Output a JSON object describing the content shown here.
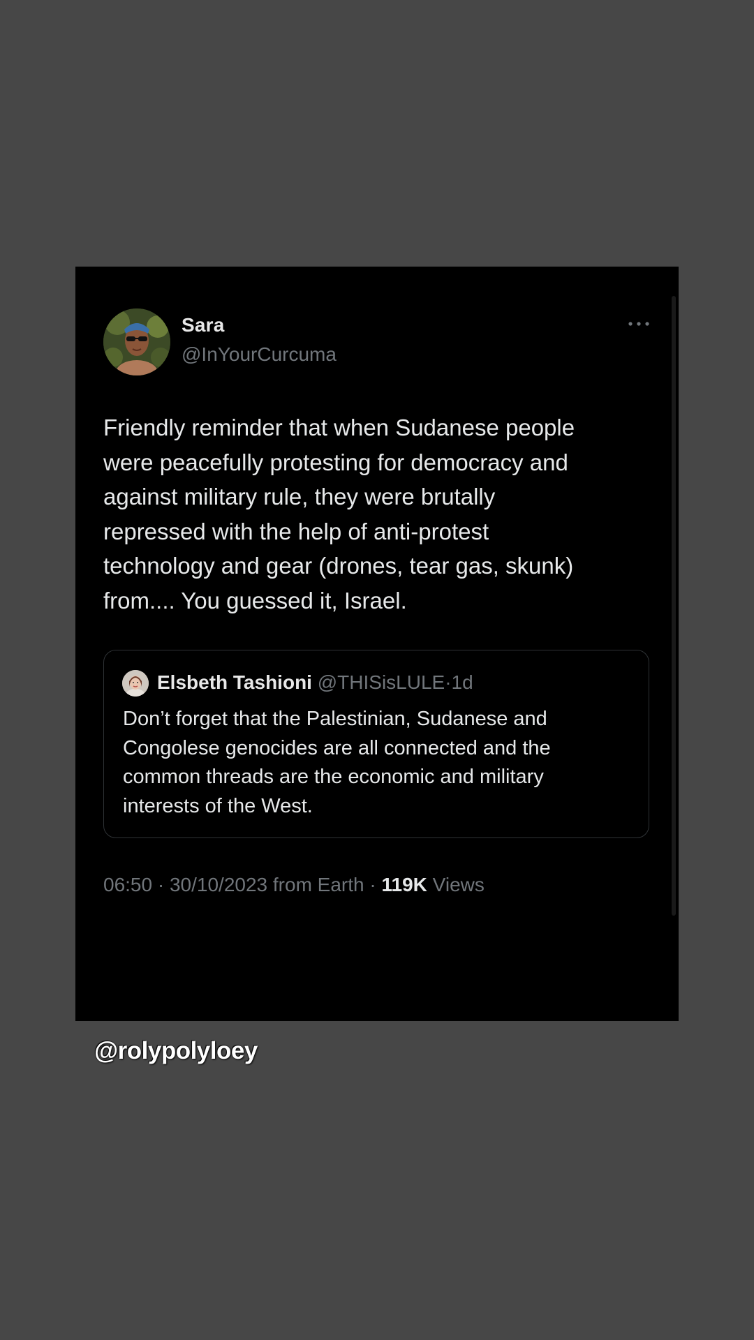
{
  "tweet": {
    "author": {
      "display_name": "Sara",
      "handle": "@InYourCurcuma",
      "avatar_icon": "profile-photo"
    },
    "more_icon": "ellipsis-icon",
    "text": "Friendly reminder that when Sudanese people\nwere peacefully protesting for democracy and\nagainst military rule, they were brutally\nrepressed with the help of anti-protest\ntechnology and gear (drones, tear gas, skunk)\nfrom.... You guessed it, Israel.",
    "quoted_tweet": {
      "display_name": "Elsbeth Tashioni",
      "handle": "@THISisLULE",
      "separator": "·",
      "time": "1d",
      "text": "Don’t forget that the Palestinian, Sudanese and\nCongolese genocides are all connected and the\ncommon threads are the economic and military\ninterests of the West."
    },
    "meta": {
      "time": "06:50",
      "separator": "·",
      "date": "30/10/2023",
      "source": "from Earth",
      "views_count": "119K",
      "views_label": "Views"
    }
  },
  "overlay": {
    "watermark": "@rolypolyloey"
  },
  "colors": {
    "page_background": "#474747",
    "card_background": "#000000",
    "primary_text": "#e7e9ea",
    "secondary_text": "#71767b",
    "quote_border": "#2f3336"
  }
}
